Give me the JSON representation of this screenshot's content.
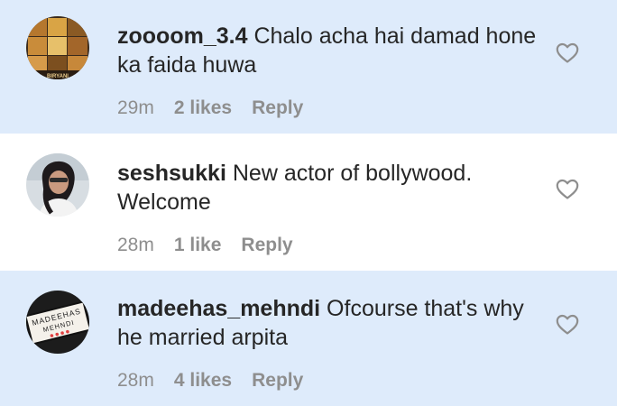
{
  "comments": [
    {
      "username": "zoooom_3.4",
      "text": "Chalo acha hai damad hone ka faida huwa",
      "time": "29m",
      "likes": "2 likes",
      "reply": "Reply",
      "avatar_icon": "food-collage-avatar",
      "avatar_text": "BIRYANI",
      "highlighted": true
    },
    {
      "username": "seshsukki",
      "text": "New actor of bollywood. Welcome",
      "time": "28m",
      "likes": "1 like",
      "reply": "Reply",
      "avatar_icon": "person-photo-avatar",
      "highlighted": false
    },
    {
      "username": "madeehas_mehndi",
      "text": "Ofcourse that's why he married arpita",
      "time": "28m",
      "likes": "4 likes",
      "reply": "Reply",
      "avatar_icon": "lightbox-sign-avatar",
      "avatar_text_line1": "MADEEHAS",
      "avatar_text_line2": "MEHNDI",
      "highlighted": true
    }
  ],
  "colors": {
    "highlight_bg": "#deebfb",
    "text": "#262626",
    "meta": "#8e8e8e"
  }
}
